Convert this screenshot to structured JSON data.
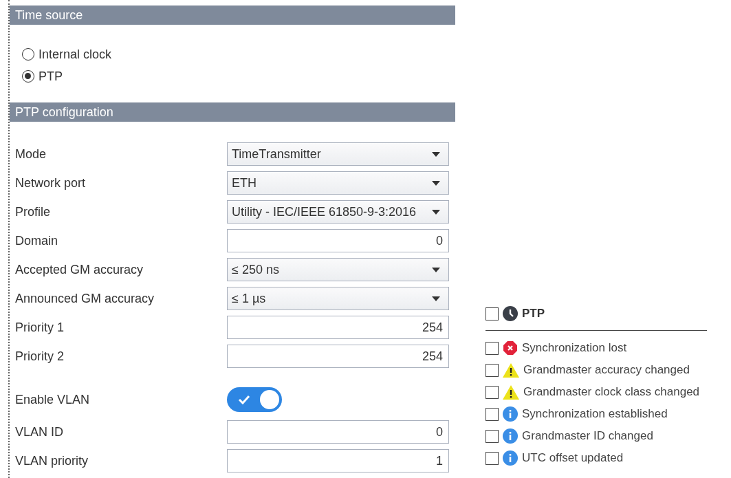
{
  "time_source": {
    "title": "Time source",
    "options": [
      {
        "label": "Internal clock",
        "selected": false
      },
      {
        "label": "PTP",
        "selected": true
      }
    ]
  },
  "ptp_configuration": {
    "title": "PTP configuration",
    "fields": [
      {
        "kind": "select",
        "label": "Mode",
        "value": "TimeTransmitter"
      },
      {
        "kind": "select",
        "label": "Network port",
        "value": "ETH"
      },
      {
        "kind": "select",
        "label": "Profile",
        "value": "Utility - IEC/IEEE 61850-9-3:2016"
      },
      {
        "kind": "number",
        "label": "Domain",
        "value": "0"
      },
      {
        "kind": "select",
        "label": "Accepted GM accuracy",
        "value": "≤ 250 ns"
      },
      {
        "kind": "select",
        "label": "Announced GM accuracy",
        "value": "≤ 1 µs"
      },
      {
        "kind": "number",
        "label": "Priority 1",
        "value": "254"
      },
      {
        "kind": "number",
        "label": "Priority 2",
        "value": "254"
      },
      {
        "kind": "toggle",
        "label": "Enable VLAN",
        "on": true
      },
      {
        "kind": "number",
        "label": "VLAN ID",
        "value": "0"
      },
      {
        "kind": "number",
        "label": "VLAN priority",
        "value": "1"
      }
    ]
  },
  "events": {
    "group": {
      "label": "PTP",
      "checked": false
    },
    "items": [
      {
        "kind": "error",
        "label": "Synchronization lost",
        "checked": false
      },
      {
        "kind": "warning",
        "label": "Grandmaster accuracy changed",
        "checked": false
      },
      {
        "kind": "warning",
        "label": "Grandmaster clock class changed",
        "checked": false
      },
      {
        "kind": "info",
        "label": "Synchronization established",
        "checked": false
      },
      {
        "kind": "info",
        "label": "Grandmaster ID changed",
        "checked": false
      },
      {
        "kind": "info",
        "label": "UTC offset updated",
        "checked": false
      }
    ]
  }
}
